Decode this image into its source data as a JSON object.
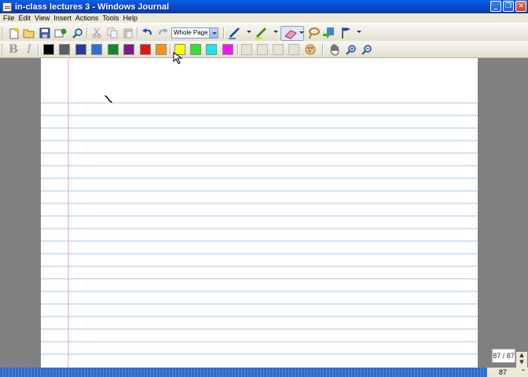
{
  "window": {
    "title": "in-class lectures 3 - Windows Journal",
    "buttons": [
      "minimize",
      "restore",
      "close"
    ]
  },
  "menu": [
    "File",
    "Edit",
    "View",
    "Insert",
    "Actions",
    "Tools",
    "Help"
  ],
  "toolbar": {
    "zoom_value": "Whole Page",
    "icons": [
      "new-note-icon",
      "open-icon",
      "save-icon",
      "send-icon",
      "find-icon",
      "cut-icon",
      "copy-icon",
      "paste-icon",
      "undo-icon",
      "redo-icon",
      "pen-icon",
      "highlighter-icon",
      "eraser-icon",
      "lasso-icon",
      "insert-space-icon",
      "flag-icon"
    ]
  },
  "format_toolbar": {
    "bold": "B",
    "italic": "I",
    "colors": [
      "#000000",
      "#606060",
      "#2a3a9a",
      "#2f6fd8",
      "#128a2a",
      "#7a1a8a",
      "#e01818",
      "#f89418",
      "#ffff00",
      "#34e034",
      "#18e8e8",
      "#f018f0"
    ],
    "icons": [
      "pen-style-icon",
      "hand-icon",
      "zoom-in-icon",
      "zoom-out-icon"
    ]
  },
  "page": {
    "indicator": "87 / 87"
  },
  "status": {
    "page_number": "87"
  }
}
